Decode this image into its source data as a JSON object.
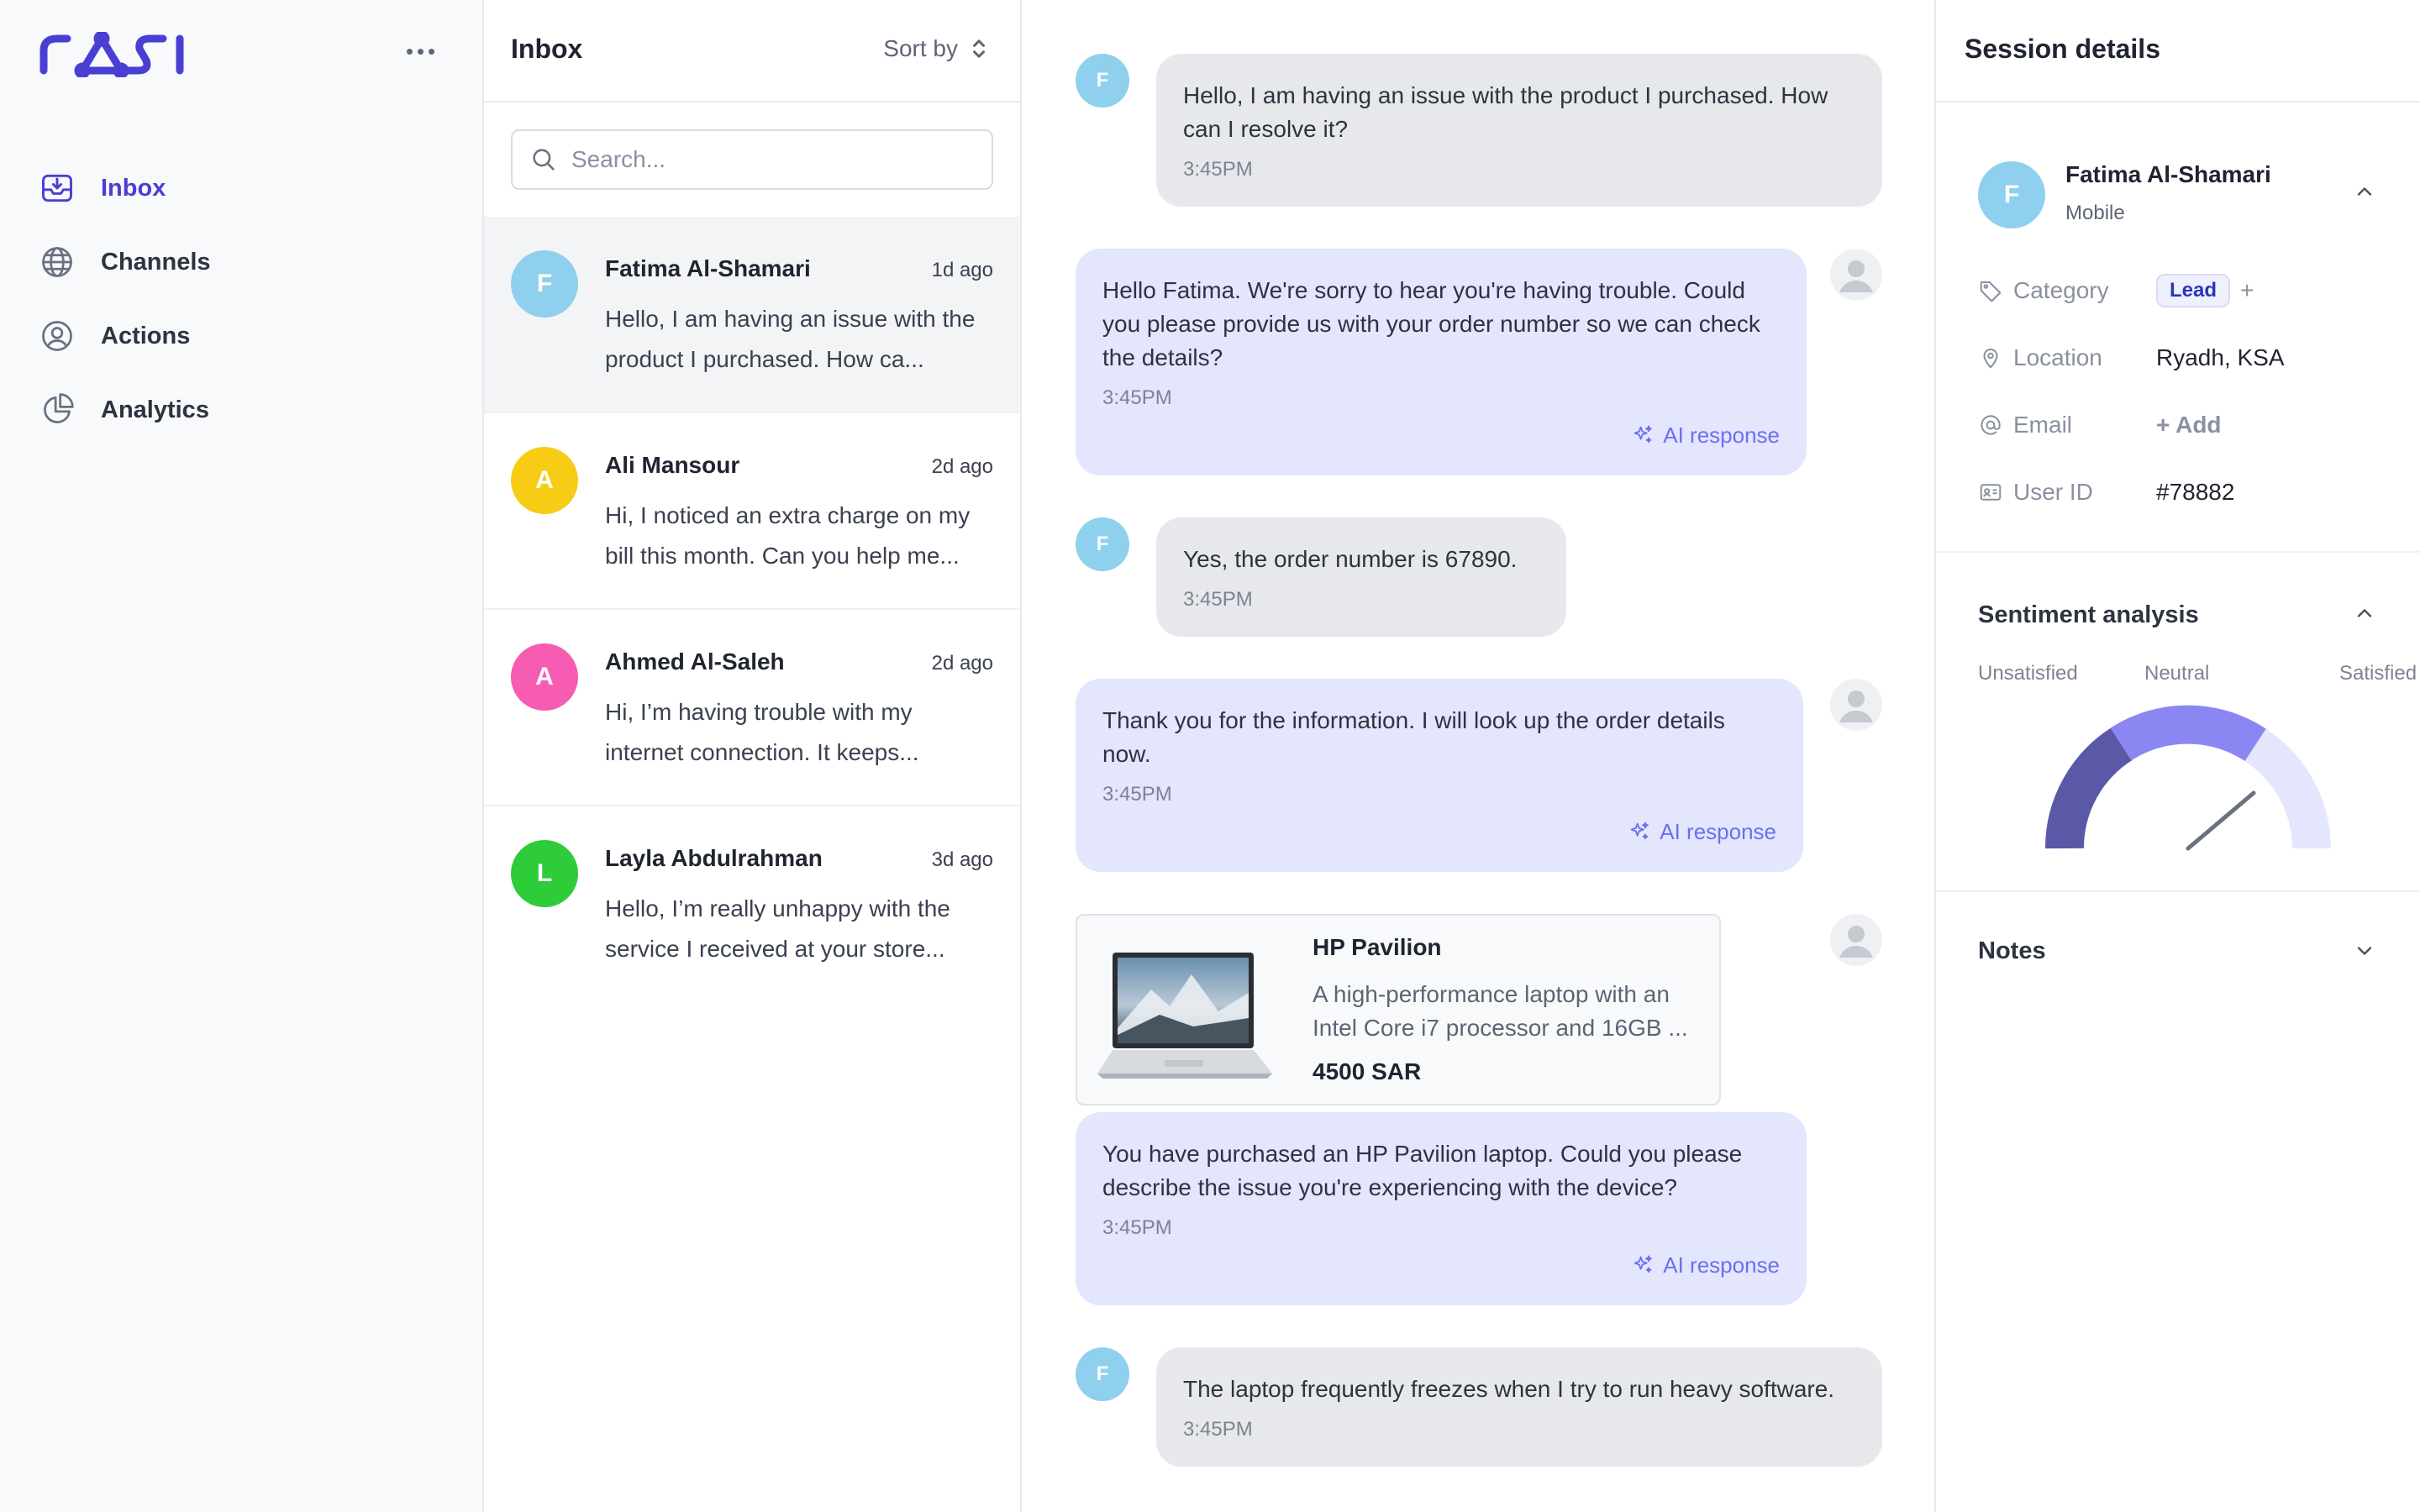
{
  "brand": {
    "logo_text": "rasi",
    "accent": "#4a3fd3"
  },
  "sidebar": {
    "more_icon": "more-horizontal-icon",
    "items": [
      {
        "label": "Inbox",
        "icon": "inbox-icon",
        "active": true
      },
      {
        "label": "Channels",
        "icon": "globe-icon",
        "active": false
      },
      {
        "label": "Actions",
        "icon": "user-circle-icon",
        "active": false
      },
      {
        "label": "Analytics",
        "icon": "pie-chart-icon",
        "active": false
      }
    ]
  },
  "inbox": {
    "title": "Inbox",
    "sort_label": "Sort by",
    "search_placeholder": "Search...",
    "conversations": [
      {
        "initial": "F",
        "name": "Fatima Al-Shamari",
        "time": "1d ago",
        "preview": "Hello, I am having an issue with the product I purchased. How ca...",
        "color": "#8fd0ee",
        "selected": true
      },
      {
        "initial": "A",
        "name": "Ali Mansour",
        "time": "2d ago",
        "preview": "Hi, I noticed an extra charge on my bill this month. Can you help me...",
        "color": "#f7cc14",
        "selected": false
      },
      {
        "initial": "A",
        "name": "Ahmed Al-Saleh",
        "time": "2d ago",
        "preview": "Hi, I’m having trouble with my internet connection. It keeps...",
        "color": "#f65cb1",
        "selected": false
      },
      {
        "initial": "L",
        "name": "Layla Abdulrahman",
        "time": "3d ago",
        "preview": "Hello, I’m really unhappy with the service I received at your store...",
        "color": "#2fcc3a",
        "selected": false
      }
    ]
  },
  "chat": {
    "ai_label": "AI response",
    "messages": [
      {
        "from": "user",
        "initial": "F",
        "text": "Hello, I am having an issue with the product I purchased. How can I resolve it?",
        "time": "3:45PM"
      },
      {
        "from": "bot",
        "text": "Hello Fatima. We're sorry to hear you're having trouble. Could you please provide us with your order number so we can check the details?",
        "time": "3:45PM"
      },
      {
        "from": "user",
        "initial": "F",
        "text": "Yes, the order number is 67890.",
        "time": "3:45PM"
      },
      {
        "from": "bot",
        "text": "Thank you for the information. I will look up the order details now.",
        "time": "3:45PM"
      },
      {
        "from": "bot",
        "text": "You have purchased an HP Pavilion laptop. Could you please describe the issue you're experiencing with the device?",
        "time": "3:45PM"
      },
      {
        "from": "user",
        "initial": "F",
        "text": "The laptop frequently freezes when I try to run heavy software.",
        "time": "3:45PM"
      }
    ],
    "product": {
      "name": "HP Pavilion",
      "description": "A high-performance laptop with an Intel Core i7 processor and 16GB ...",
      "price": "4500 SAR"
    }
  },
  "details": {
    "title": "Session details",
    "profile": {
      "initial": "F",
      "name": "Fatima Al-Shamari",
      "device": "Mobile"
    },
    "fields": {
      "category_label": "Category",
      "category_value": "Lead",
      "category_add": "+",
      "location_label": "Location",
      "location_value": "Ryadh, KSA",
      "email_label": "Email",
      "email_value": "+ Add",
      "userid_label": "User ID",
      "userid_value": "#78882"
    },
    "sentiment": {
      "title": "Sentiment analysis",
      "labels": [
        "Unsatisfied",
        "Neutral",
        "Satisfied"
      ],
      "colors": [
        "#5b58a8",
        "#8b87f2",
        "#e3e6fc"
      ]
    },
    "notes_title": "Notes"
  }
}
